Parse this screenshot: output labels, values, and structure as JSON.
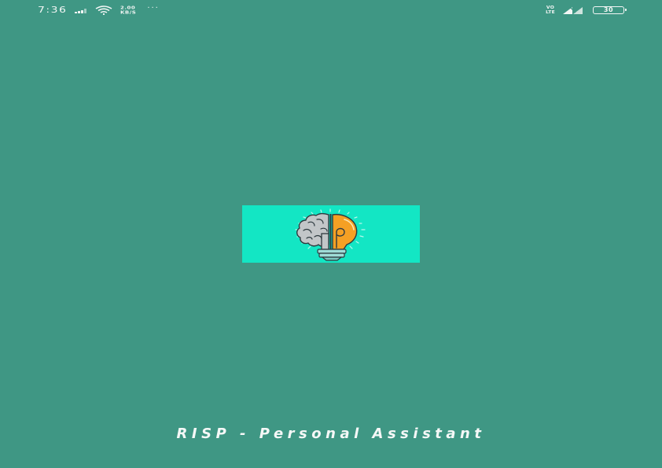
{
  "status_bar": {
    "time": "7:36",
    "network_speed_value": "2.00",
    "network_speed_unit": "KB/S",
    "more_indicator": "···",
    "volte_top": "VO",
    "volte_bottom": "LTE",
    "battery_level": "30",
    "icons": [
      "signal-strength-icon",
      "wifi-icon",
      "cellular-signal-icon",
      "battery-icon"
    ]
  },
  "splash": {
    "logo_icon": "brain-lightbulb-logo",
    "logo_background": "#13e6c4",
    "brain_color": "#c2c6c8",
    "bulb_color": "#f5a024",
    "page_background": "#3f9784"
  },
  "app_name": "RISP - Personal Assistant"
}
